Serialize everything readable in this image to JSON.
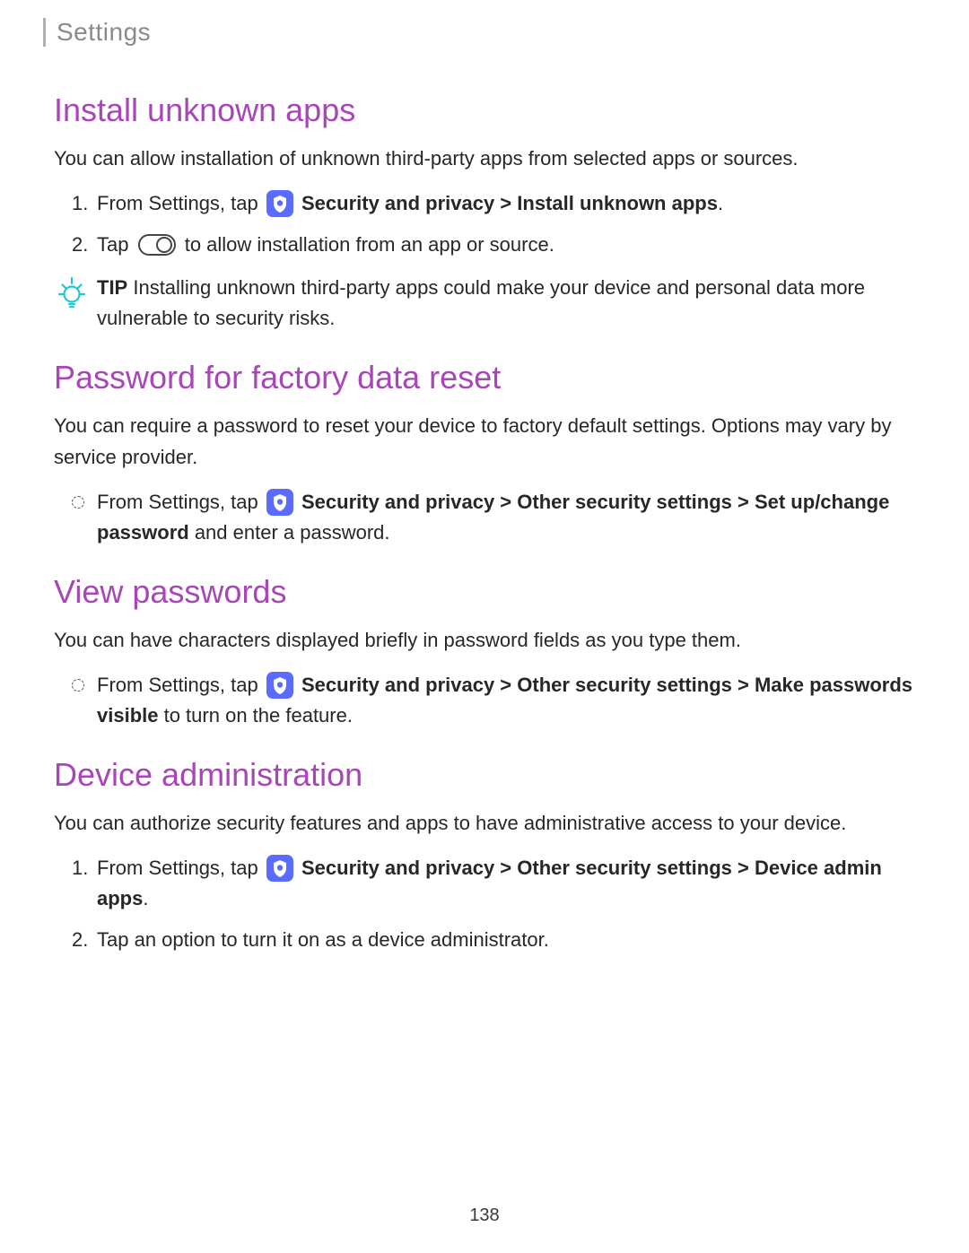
{
  "header": {
    "title": "Settings"
  },
  "sections": {
    "install": {
      "heading": "Install unknown apps",
      "intro": "You can allow installation of unknown third-party apps from selected apps or sources.",
      "step1_prefix": "From Settings, tap ",
      "step1_bold": "Security and privacy > Install unknown apps",
      "step1_suffix": ".",
      "step2_prefix": "Tap ",
      "step2_suffix": " to allow installation from an app or source."
    },
    "tip": {
      "label": "TIP",
      "text": "  Installing unknown third-party apps could make your device and personal data more vulnerable to security risks."
    },
    "password_reset": {
      "heading": "Password for factory data reset",
      "intro": "You can require a password to reset your device to factory default settings. Options may vary by service provider.",
      "bullet_prefix": "From Settings, tap ",
      "bullet_bold1": "Security and privacy > Other security settings > Set up/change password",
      "bullet_suffix": " and enter a password."
    },
    "view_passwords": {
      "heading": "View passwords",
      "intro": "You can have characters displayed briefly in password fields as you type them.",
      "bullet_prefix": "From Settings, tap ",
      "bullet_bold1": "Security and privacy > Other security settings > Make passwords visible",
      "bullet_suffix": " to turn on the feature."
    },
    "device_admin": {
      "heading": "Device administration",
      "intro": "You can authorize security features and apps to have administrative access to your device.",
      "step1_prefix": "From Settings, tap ",
      "step1_bold": "Security and privacy > Other security settings > Device admin apps",
      "step1_suffix": ".",
      "step2": "Tap an option to turn it on as a device administrator."
    }
  },
  "page_number": "138"
}
